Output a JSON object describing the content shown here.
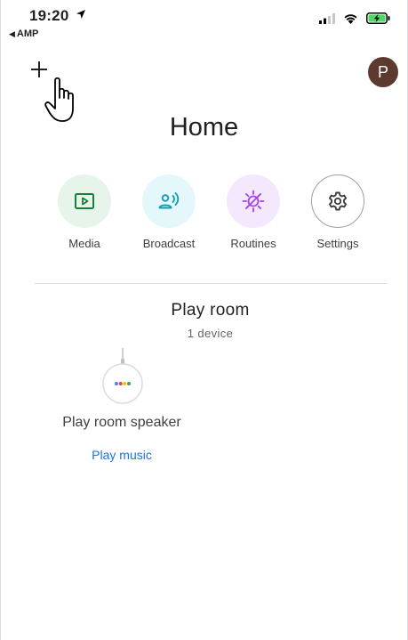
{
  "status_bar": {
    "time": "19:20",
    "back_app": "AMP"
  },
  "header": {
    "add_icon": "plus-icon",
    "avatar_initial": "P",
    "avatar_color": "#5d3a2e",
    "title": "Home"
  },
  "quick_actions": [
    {
      "label": "Media",
      "icon": "media-icon",
      "bg": "#e6f4ea",
      "fg": "#188038"
    },
    {
      "label": "Broadcast",
      "icon": "broadcast-icon",
      "bg": "#e4f7fb",
      "fg": "#129eaf"
    },
    {
      "label": "Routines",
      "icon": "routines-icon",
      "bg": "#f3e8fd",
      "fg": "#a142f4"
    },
    {
      "label": "Settings",
      "icon": "settings-icon",
      "bg": "#ffffff",
      "fg": "#3c4043"
    }
  ],
  "room": {
    "name": "Play room",
    "device_count": "1 device",
    "devices": [
      {
        "name": "Play room speaker",
        "action": "Play music",
        "icon": "google-home-mini-icon"
      }
    ]
  },
  "colors": {
    "accent": "#1a73e8",
    "speaker_dots": [
      "#4285f4",
      "#ea4335",
      "#fbbc05",
      "#34a853"
    ]
  }
}
